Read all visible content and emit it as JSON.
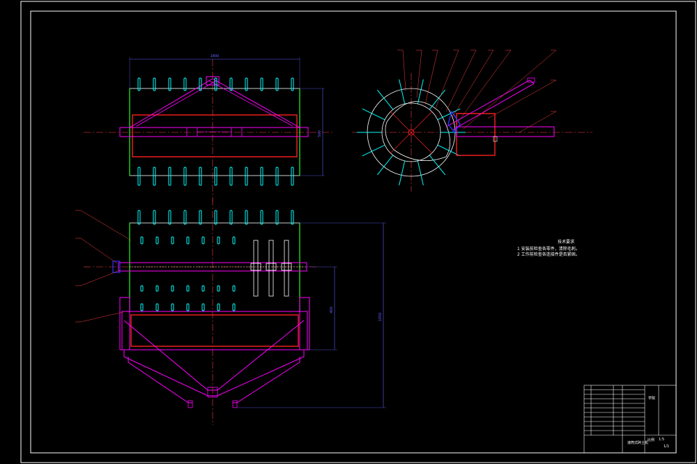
{
  "notes": {
    "title": "技术要求",
    "items": [
      "1  安装前检查各零件，清除毛刺。",
      "2  工作前检查各连接件是否紧固。"
    ]
  },
  "dimensions": {
    "top_width": "1800",
    "top_height": "500",
    "front_height_small": "400",
    "front_height_large": "1050"
  },
  "title_block": {
    "scale_label": "比例",
    "scale_value": "1:5",
    "sheet": "1/1",
    "drawing_name": "滚筒式碎土机",
    "school": "学院"
  },
  "colors": {
    "frame": "#ffffff",
    "magenta": "#ff00ff",
    "red": "#ff2020",
    "cyan": "#00ffff",
    "green": "#20ff20",
    "blue": "#3030ff",
    "dim": "#6060ff",
    "leader": "#ff4040"
  }
}
